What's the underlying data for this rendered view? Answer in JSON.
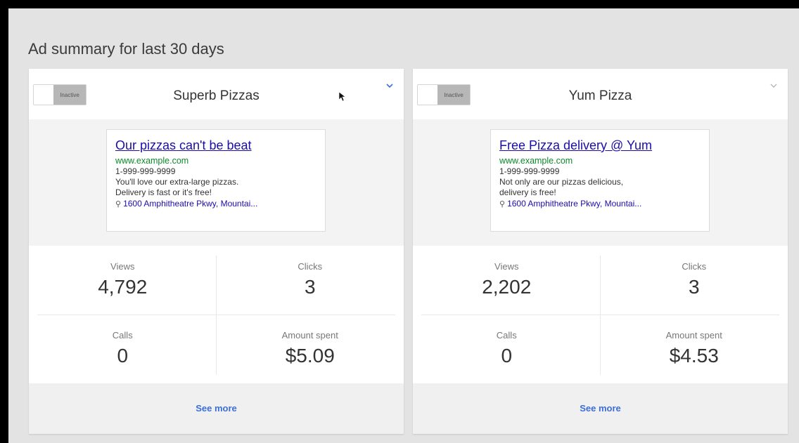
{
  "page": {
    "title": "Ad summary for last 30 days"
  },
  "cards": [
    {
      "toggle_label": "Inactive",
      "title": "Superb Pizzas",
      "chevron_color": "#3b6fd6",
      "ad": {
        "headline": "Our pizzas can't be beat",
        "url": "www.example.com",
        "phone": "1-999-999-9999",
        "desc1": "You'll love our extra-large pizzas.",
        "desc2": "Delivery is fast or it's free!",
        "location": "1600 Amphitheatre Pkwy, Mountai..."
      },
      "stats": {
        "views_label": "Views",
        "views": "4,792",
        "clicks_label": "Clicks",
        "clicks": "3",
        "calls_label": "Calls",
        "calls": "0",
        "spent_label": "Amount spent",
        "spent": "$5.09"
      },
      "see_more": "See more"
    },
    {
      "toggle_label": "Inactive",
      "title": "Yum Pizza",
      "chevron_color": "#aaaaaa",
      "ad": {
        "headline": "Free Pizza delivery @ Yum",
        "url": "www.example.com",
        "phone": "1-999-999-9999",
        "desc1": "Not only are our pizzas delicious,",
        "desc2": "delivery is free!",
        "location": "1600 Amphitheatre Pkwy, Mountai..."
      },
      "stats": {
        "views_label": "Views",
        "views": "2,202",
        "clicks_label": "Clicks",
        "clicks": "3",
        "calls_label": "Calls",
        "calls": "0",
        "spent_label": "Amount spent",
        "spent": "$4.53"
      },
      "see_more": "See more"
    }
  ],
  "icons": {
    "location": "location-pin-icon",
    "expand": "chevron-down-icon",
    "pointer": "mouse-cursor-icon"
  },
  "colors": {
    "link": "#1a0dab",
    "url_green": "#0d8a2b",
    "accent": "#3b6fd6"
  }
}
